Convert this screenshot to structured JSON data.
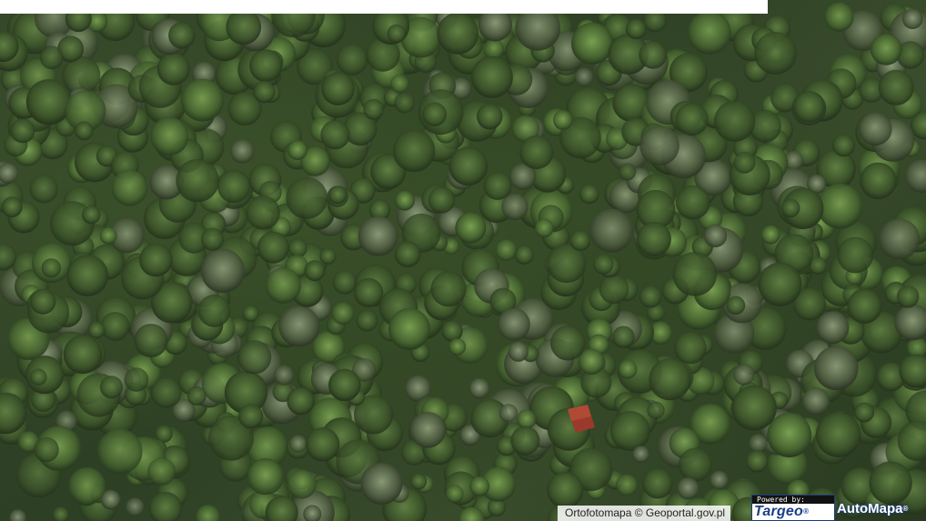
{
  "map": {
    "type": "aerial orthophoto",
    "attribution": "Ortofotomapa © Geoportal.gov.pl",
    "brand": {
      "powered_by": "Powered by:",
      "targeo": "Targeo",
      "automapa": "AutoMapa"
    }
  },
  "colors": {
    "forest_dark": "#2d3f24",
    "forest_light": "#3a4d2c",
    "roof_red": "#9a3a2c",
    "targeo_blue": "#1c3f86"
  }
}
